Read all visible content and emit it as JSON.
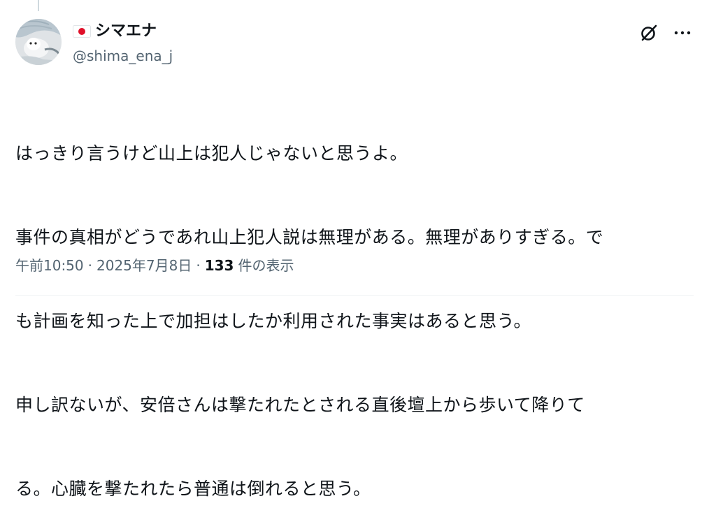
{
  "author": {
    "display_name": "シマエナ",
    "handle": "@shima_ena_j",
    "flag_icon": "japan-flag-icon",
    "flag_colors": {
      "field": "#ffffff",
      "circle": "#e0102a"
    }
  },
  "header_actions": {
    "grok_icon": "grok-icon",
    "more_icon": "more-icon"
  },
  "tweet": {
    "lines": [
      "はっきり言うけど山上は犯人じゃないと思うよ。",
      "事件の真相がどうであれ山上犯人説は無理がある。無理がありすぎる。で",
      "も計画を知った上で加担はしたか利用された事実はあると思う。",
      "申し訳ないが、安倍さんは撃たれたとされる直後壇上から歩いて降りて",
      "る。心臓を撃たれたら普通は倒れると思う。"
    ]
  },
  "meta": {
    "time": "午前10:50",
    "separator": "·",
    "date": "2025年7月8日",
    "views_count": "133",
    "views_label": "件の表示"
  },
  "colors": {
    "text_primary": "#0f1419",
    "text_secondary": "#536471",
    "divider": "#eff3f4"
  }
}
